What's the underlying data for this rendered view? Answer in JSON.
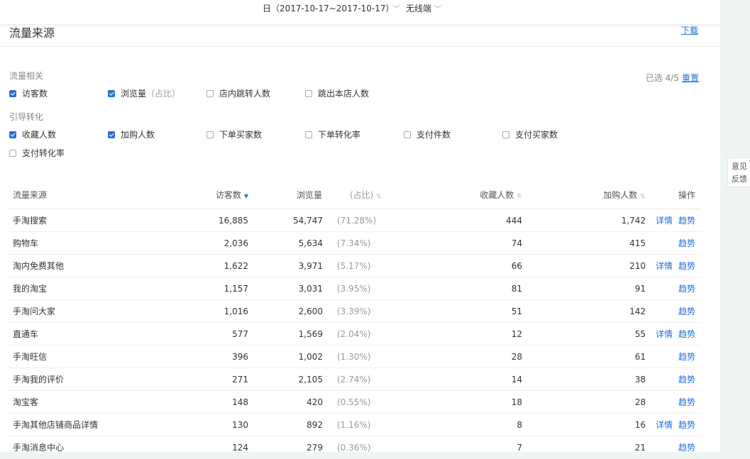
{
  "header": {
    "date_range": "日（2017-10-17~2017-10-17）",
    "terminal": "无线端"
  },
  "section": {
    "title": "流量来源",
    "download": "下载"
  },
  "filters": {
    "group1_label": "流量相关",
    "group2_label": "引导转化",
    "selected_count": "已选 4/5",
    "reset": "重置",
    "items": [
      {
        "label": "访客数",
        "checked": true
      },
      {
        "label": "浏览量",
        "hint": "（占比）",
        "checked": true
      },
      {
        "label": "店内跳转人数",
        "checked": false
      },
      {
        "label": "跳出本店人数",
        "checked": false
      },
      {
        "label": "收藏人数",
        "checked": true
      },
      {
        "label": "加购人数",
        "checked": true
      },
      {
        "label": "下单买家数",
        "checked": false
      },
      {
        "label": "下单转化率",
        "checked": false
      },
      {
        "label": "支付件数",
        "checked": false
      },
      {
        "label": "支付买家数",
        "checked": false
      },
      {
        "label": "支付转化率",
        "checked": false
      }
    ]
  },
  "table": {
    "headers": {
      "source": "流量来源",
      "visitors": "访客数",
      "pv": "浏览量",
      "ratio": "(占比)",
      "fav": "收藏人数",
      "cart": "加购人数",
      "op": "操作"
    },
    "detail_label": "详情",
    "trend_label": "趋势",
    "rows": [
      {
        "source": "手淘搜索",
        "visitors": "16,885",
        "pv": "54,747",
        "ratio": "(71.28%)",
        "fav": "444",
        "cart": "1,742",
        "detail": true
      },
      {
        "source": "购物车",
        "visitors": "2,036",
        "pv": "5,634",
        "ratio": "(7.34%)",
        "fav": "74",
        "cart": "415",
        "detail": false
      },
      {
        "source": "淘内免费其他",
        "visitors": "1,622",
        "pv": "3,971",
        "ratio": "(5.17%)",
        "fav": "66",
        "cart": "210",
        "detail": true
      },
      {
        "source": "我的淘宝",
        "visitors": "1,157",
        "pv": "3,031",
        "ratio": "(3.95%)",
        "fav": "81",
        "cart": "91",
        "detail": false
      },
      {
        "source": "手淘问大家",
        "visitors": "1,016",
        "pv": "2,600",
        "ratio": "(3.39%)",
        "fav": "51",
        "cart": "142",
        "detail": false
      },
      {
        "source": "直通车",
        "visitors": "577",
        "pv": "1,569",
        "ratio": "(2.04%)",
        "fav": "12",
        "cart": "55",
        "detail": true
      },
      {
        "source": "手淘旺信",
        "visitors": "396",
        "pv": "1,002",
        "ratio": "(1.30%)",
        "fav": "28",
        "cart": "61",
        "detail": false
      },
      {
        "source": "手淘我的评价",
        "visitors": "271",
        "pv": "2,105",
        "ratio": "(2.74%)",
        "fav": "14",
        "cart": "38",
        "detail": false
      },
      {
        "source": "淘宝客",
        "visitors": "148",
        "pv": "420",
        "ratio": "(0.55%)",
        "fav": "18",
        "cart": "28",
        "detail": false
      },
      {
        "source": "手淘其他店铺商品详情",
        "visitors": "130",
        "pv": "892",
        "ratio": "(1.16%)",
        "fav": "8",
        "cart": "16",
        "detail": true
      },
      {
        "source": "手淘消息中心",
        "visitors": "124",
        "pv": "279",
        "ratio": "(0.36%)",
        "fav": "7",
        "cart": "21",
        "detail": false
      }
    ]
  },
  "feedback": {
    "line1": "意见",
    "line2": "反馈"
  }
}
